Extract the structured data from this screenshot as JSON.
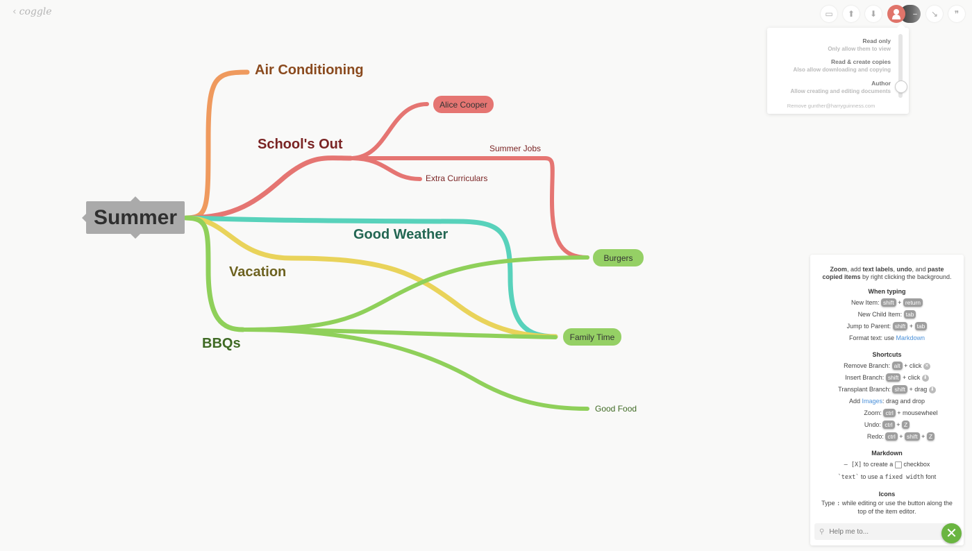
{
  "header": {
    "back_glyph": "‹",
    "app_name": "coggle",
    "toolbar": [
      {
        "name": "present-icon",
        "glyph": "▭"
      },
      {
        "name": "share-upload-icon",
        "glyph": "⬆"
      },
      {
        "name": "download-icon",
        "glyph": "⬇"
      }
    ],
    "extra_tools": [
      {
        "name": "history-icon",
        "glyph": "↘"
      },
      {
        "name": "comments-icon",
        "glyph": "❞"
      }
    ],
    "collaborator_remove_glyph": "–"
  },
  "share_popover": {
    "options": [
      {
        "title": "Read only",
        "desc": "Only allow them to view"
      },
      {
        "title": "Read & create copies",
        "desc": "Also allow downloading and copying"
      },
      {
        "title": "Author",
        "desc": "Allow creating and editing documents"
      }
    ],
    "selected": "Author",
    "remove_label": "Remove gunther@harryguinness.com"
  },
  "mindmap": {
    "root": {
      "label": "Summer"
    },
    "branches": [
      {
        "label": "Air Conditioning",
        "color": "#ef9a5e",
        "text_color": "#8a4a1e"
      },
      {
        "label": "School's Out",
        "color": "#e57572",
        "text_color": "#7a2424",
        "children": [
          {
            "label": "Alice Cooper",
            "style": "pill"
          },
          {
            "label": "Summer Jobs",
            "style": "text"
          },
          {
            "label": "Extra Curriculars",
            "style": "text"
          }
        ]
      },
      {
        "label": "Good Weather",
        "color": "#58d2bb",
        "text_color": "#226652"
      },
      {
        "label": "Vacation",
        "color": "#e9d35a",
        "text_color": "#6d6220"
      },
      {
        "label": "BBQs",
        "color": "#8fd05a",
        "text_color": "#3f6a24",
        "children": [
          {
            "label": "Burgers",
            "style": "pill"
          },
          {
            "label": "Family Time",
            "style": "pill"
          },
          {
            "label": "Good Food",
            "style": "text"
          }
        ]
      }
    ],
    "pill_color": "#e57572",
    "pill_green": "#95d065"
  },
  "help": {
    "intro_parts": [
      "Zoom",
      ", add ",
      "text labels",
      ", ",
      "undo",
      ", and ",
      "paste copied items",
      " by right clicking the background."
    ],
    "when_typing_title": "When typing",
    "when_typing": [
      {
        "label": "New Item:",
        "keys": [
          "shift",
          "return"
        ]
      },
      {
        "label": "New Child Item:",
        "keys": [
          "tab"
        ]
      },
      {
        "label": "Jump to Parent:",
        "keys": [
          "shift",
          "tab"
        ]
      }
    ],
    "format_label": "Format text: use",
    "format_link": "Markdown",
    "shortcuts_title": "Shortcuts",
    "shortcuts": [
      {
        "label": "Remove Branch:",
        "key": "alt",
        "action": "+ click",
        "icon": "✕"
      },
      {
        "label": "Insert Branch:",
        "key": "shift",
        "action": "+ click",
        "icon": "⬇"
      },
      {
        "label": "Transplant Branch:",
        "key": "shift",
        "action": "+ drag",
        "icon": "⬇"
      }
    ],
    "add_label": "Add",
    "images_link": "Images",
    "add_rest": ": drag and drop",
    "zoom": {
      "label": "Zoom:",
      "key": "ctrl",
      "rest": "+ mousewheel"
    },
    "undo": {
      "label": "Undo:",
      "keys": [
        "ctrl",
        "Z"
      ]
    },
    "redo": {
      "label": "Redo:",
      "keys": [
        "ctrl",
        "shift",
        "Z"
      ]
    },
    "markdown_title": "Markdown",
    "md_checkbox_pre": "– [X]",
    "md_checkbox_mid": "to create a",
    "md_checkbox_post": "checkbox",
    "md_code_pre": "`text`",
    "md_code_mid": "to use a",
    "md_code_mono": "fixed width",
    "md_code_post": "font",
    "icons_title": "Icons",
    "icons_text_pre": "Type",
    "icons_text_mono": ":",
    "icons_text_post": "while editing or use the button along the top of the item editor.",
    "search_placeholder": "Help me to...",
    "close_glyph": "✕"
  }
}
